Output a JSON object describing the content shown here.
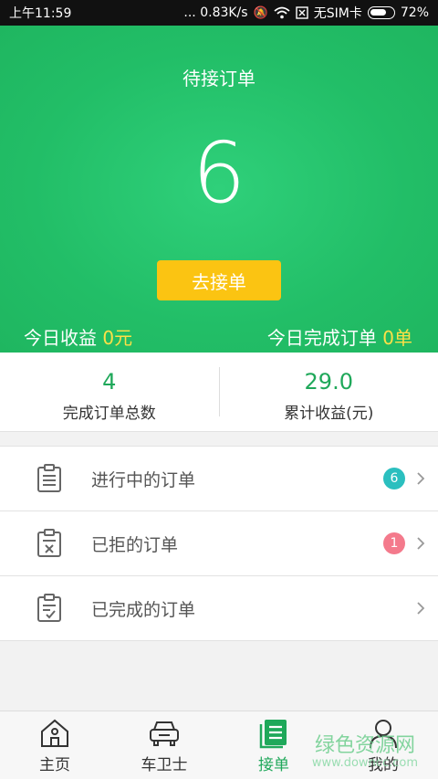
{
  "status_bar": {
    "time": "上午11:59",
    "speed": "... 0.83K/s",
    "sim": "无SIM卡",
    "battery": "72%",
    "battery_level": 0.72
  },
  "hero": {
    "title": "待接订单",
    "pending_count": "6",
    "go_button": "去接单",
    "today_earnings_label": "今日收益",
    "today_earnings_value": "0元",
    "today_done_label": "今日完成订单",
    "today_done_value": "0单"
  },
  "stats": [
    {
      "value": "4",
      "label": "完成订单总数"
    },
    {
      "value": "29.0",
      "label": "累计收益(元)"
    }
  ],
  "orders": [
    {
      "label": "进行中的订单",
      "badge": "6",
      "badge_color": "#2bbfbf"
    },
    {
      "label": "已拒的订单",
      "badge": "1",
      "badge_color": "#f47a8c"
    },
    {
      "label": "已完成的订单",
      "badge": null
    }
  ],
  "tabs": [
    {
      "label": "主页",
      "icon": "home-icon"
    },
    {
      "label": "车卫士",
      "icon": "car-icon"
    },
    {
      "label": "接单",
      "icon": "orders-icon",
      "active": true
    },
    {
      "label": "我的",
      "icon": "user-icon"
    }
  ],
  "colors": {
    "accent": "#22be67",
    "button": "#fbc412",
    "highlight": "#fde047"
  },
  "watermark": {
    "line1": "绿色资源网",
    "line2": "www.downcc.com"
  }
}
